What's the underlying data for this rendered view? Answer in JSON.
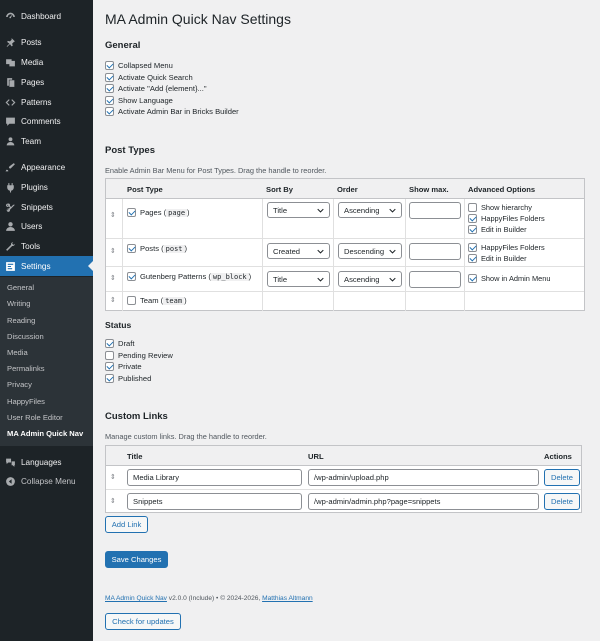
{
  "sidebar": {
    "menu": [
      {
        "label": "Dashboard",
        "icon": "dashboard-icon"
      },
      {
        "label": "Posts",
        "icon": "pin-icon"
      },
      {
        "label": "Media",
        "icon": "media-icon"
      },
      {
        "label": "Pages",
        "icon": "pages-icon"
      },
      {
        "label": "Patterns",
        "icon": "patterns-icon"
      },
      {
        "label": "Comments",
        "icon": "comments-icon"
      },
      {
        "label": "Team",
        "icon": "team-icon"
      },
      {
        "label": "Appearance",
        "icon": "appearance-icon"
      },
      {
        "label": "Plugins",
        "icon": "plugins-icon"
      },
      {
        "label": "Snippets",
        "icon": "snippets-icon"
      },
      {
        "label": "Users",
        "icon": "users-icon"
      },
      {
        "label": "Tools",
        "icon": "tools-icon"
      },
      {
        "label": "Settings",
        "icon": "settings-icon"
      }
    ],
    "submenu": [
      "General",
      "Writing",
      "Reading",
      "Discussion",
      "Media",
      "Permalinks",
      "Privacy",
      "HappyFiles",
      "User Role Editor",
      "MA Admin Quick Nav"
    ],
    "bottom": [
      {
        "label": "Languages",
        "icon": "languages-icon"
      },
      {
        "label": "Collapse Menu",
        "icon": "collapse-icon"
      }
    ]
  },
  "page": {
    "title": "MA Admin Quick Nav Settings"
  },
  "general": {
    "heading": "General",
    "options": [
      {
        "label": "Collapsed Menu",
        "checked": true
      },
      {
        "label": "Activate Quick Search",
        "checked": true
      },
      {
        "label": "Activate \"Add {element}...\"",
        "checked": true
      },
      {
        "label": "Show Language",
        "checked": true
      },
      {
        "label": "Activate Admin Bar in Bricks Builder",
        "checked": true
      }
    ]
  },
  "post_types": {
    "heading": "Post Types",
    "description": "Enable Admin Bar Menu for Post Types. Drag the handle to reorder.",
    "columns": [
      "Post Type",
      "Sort By",
      "Order",
      "Show max.",
      "Advanced Options"
    ],
    "rows": [
      {
        "label": "Pages (",
        "slug": "page",
        "close": ")",
        "checked": true,
        "sort_by": "Title",
        "order": "Ascending",
        "show_max": "",
        "options": [
          {
            "label": "Show hierarchy",
            "checked": false
          },
          {
            "label": "HappyFiles Folders",
            "checked": true
          },
          {
            "label": "Edit in Builder",
            "checked": true
          }
        ]
      },
      {
        "label": "Posts (",
        "slug": "post",
        "close": ")",
        "checked": true,
        "sort_by": "Created",
        "order": "Descending",
        "show_max": "",
        "options": [
          {
            "label": "HappyFiles Folders",
            "checked": true
          },
          {
            "label": "Edit in Builder",
            "checked": true
          }
        ]
      },
      {
        "label": "Gutenberg Patterns (",
        "slug": "wp_block",
        "close": ")",
        "checked": true,
        "sort_by": "Title",
        "order": "Ascending",
        "show_max": "",
        "options": [
          {
            "label": "Show in Admin Menu",
            "checked": true
          }
        ]
      },
      {
        "label": "Team (",
        "slug": "team",
        "close": ")",
        "checked": false
      }
    ]
  },
  "status": {
    "heading": "Status",
    "options": [
      {
        "label": "Draft",
        "checked": true
      },
      {
        "label": "Pending Review",
        "checked": false
      },
      {
        "label": "Private",
        "checked": true
      },
      {
        "label": "Published",
        "checked": true
      }
    ]
  },
  "custom_links": {
    "heading": "Custom Links",
    "description": "Manage custom links. Drag the handle to reorder.",
    "columns": [
      "Title",
      "URL",
      "Actions"
    ],
    "rows": [
      {
        "title": "Media Library",
        "url": "/wp-admin/upload.php",
        "action": "Delete"
      },
      {
        "title": "Snippets",
        "url": "/wp-admin/admin.php?page=snippets",
        "action": "Delete"
      }
    ],
    "add_label": "Add Link"
  },
  "save_label": "Save Changes",
  "footer": {
    "plugin": "MA Admin Quick Nav",
    "meta": " v2.0.0 (Include) • © 2024-2026, ",
    "author": "Matthias Altmann",
    "updates_label": "Check for updates"
  },
  "colors": {
    "accent": "#2271b1",
    "sidebar": "#1d2327",
    "submenu": "#2c3338",
    "page_bg": "#f0f0f1"
  }
}
